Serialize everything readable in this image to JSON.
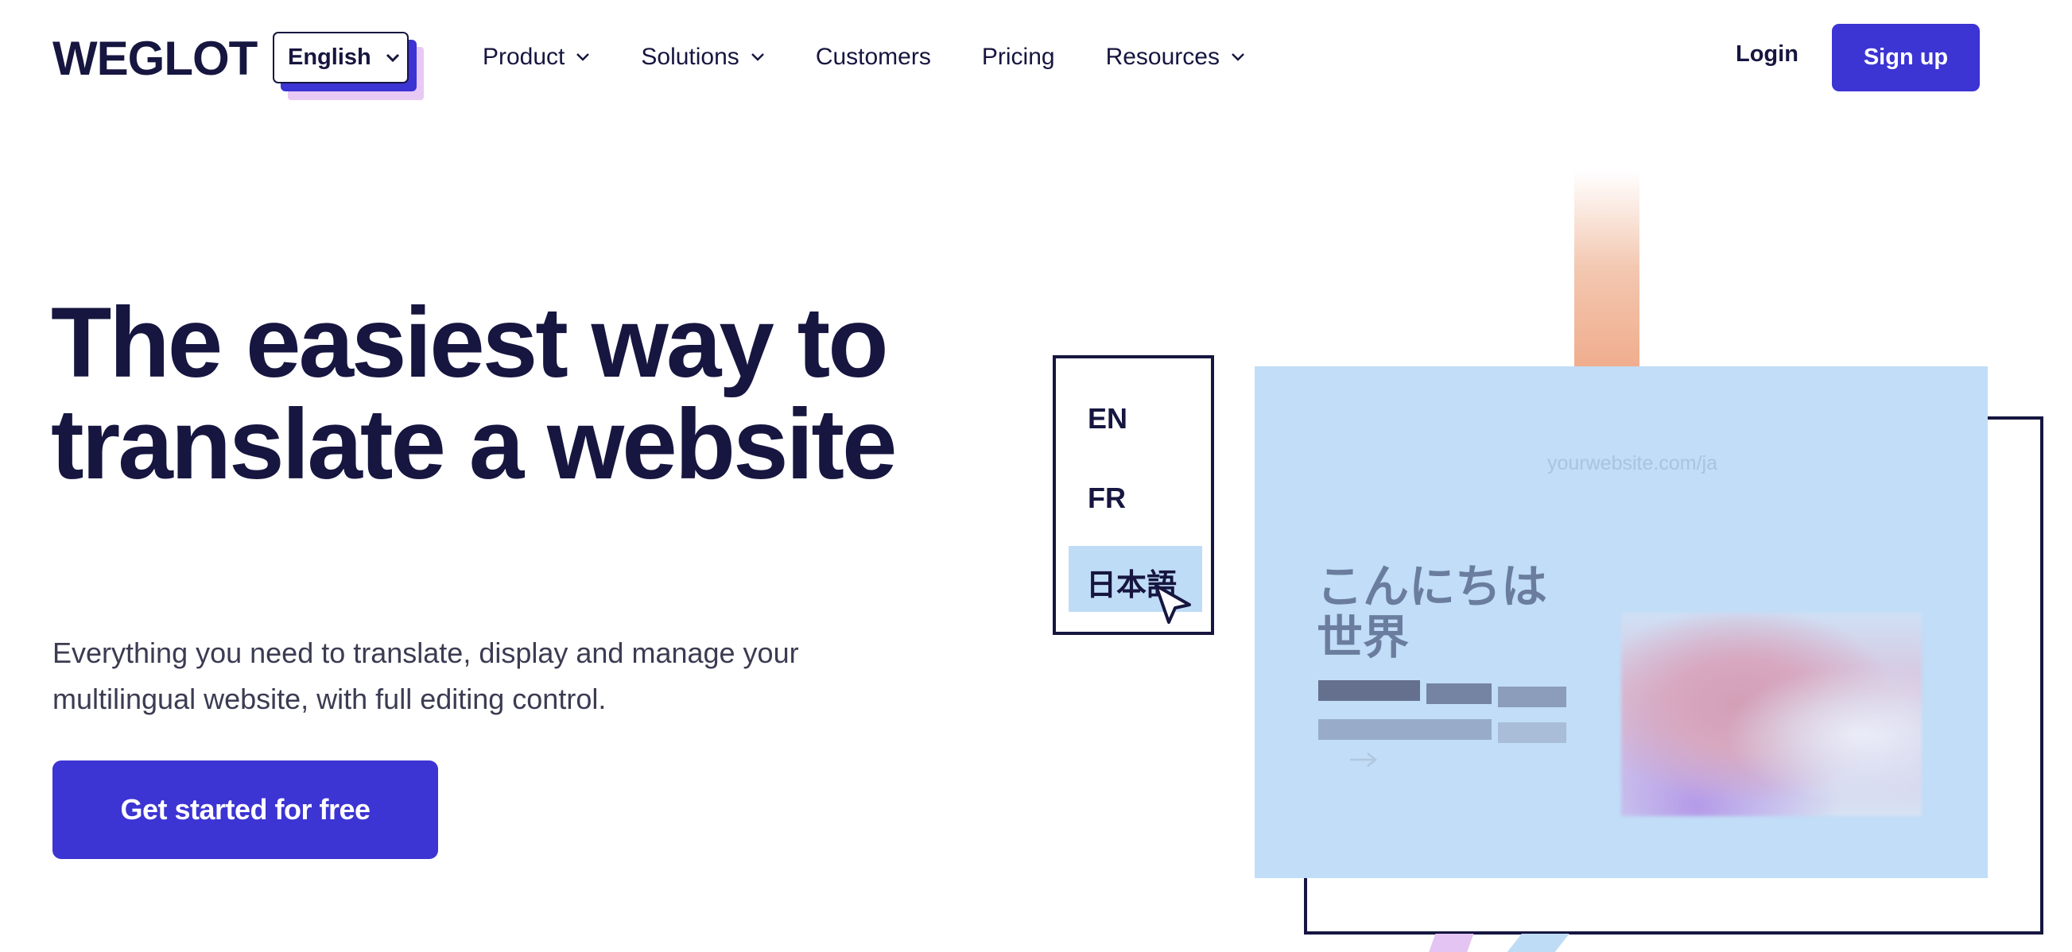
{
  "header": {
    "logo_text": "WEGLOT",
    "language_selector": {
      "selected": "English"
    },
    "nav": [
      {
        "label": "Product",
        "has_dropdown": true
      },
      {
        "label": "Solutions",
        "has_dropdown": true
      },
      {
        "label": "Customers",
        "has_dropdown": false
      },
      {
        "label": "Pricing",
        "has_dropdown": false
      },
      {
        "label": "Resources",
        "has_dropdown": true
      }
    ],
    "login_label": "Login",
    "signup_label": "Sign up"
  },
  "hero": {
    "title": "The easiest way to translate a website",
    "subtitle": "Everything you need to translate, display and manage your multilingual website, with full editing control.",
    "cta_label": "Get started for free"
  },
  "illustration": {
    "language_options": [
      "EN",
      "FR",
      "日本語"
    ],
    "selected_language": "日本語",
    "site_url": "yourwebsite.com/ja",
    "site_heading": "こんにちは世界"
  },
  "colors": {
    "brand": "#3c34d3",
    "ink": "#161640",
    "card_blue": "#c1ddf7",
    "accent_pink": "#e8c9f4",
    "accent_peach": "#f0ad8d"
  },
  "icons": {
    "dropdown": "chevron-down-icon",
    "cursor": "pointer-cursor-icon",
    "arrow": "arrow-right-icon"
  }
}
